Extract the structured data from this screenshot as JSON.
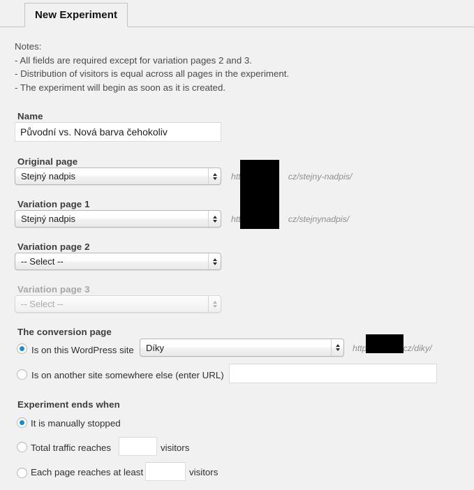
{
  "tab": {
    "label": "New Experiment"
  },
  "notes": {
    "heading": "Notes:",
    "lines": [
      "- All fields are required except for variation pages 2 and 3.",
      "- Distribution of visitors is equal across all pages in the experiment.",
      "- The experiment will begin as soon as it is created."
    ]
  },
  "name_field": {
    "label": "Name",
    "value": "Původní vs. Nová barva čehokoliv",
    "placeholder": ""
  },
  "original_page": {
    "label": "Original page",
    "selected": "Stejný nadpis",
    "url_prefix": "htt",
    "url_suffix": "cz/stejny-nadpis/"
  },
  "variation_page_1": {
    "label": "Variation page 1",
    "selected": "Stejný nadpis",
    "url_prefix": "htt",
    "url_suffix": "cz/stejnynadpis/"
  },
  "variation_page_2": {
    "label": "Variation page 2",
    "selected": "-- Select --"
  },
  "variation_page_3": {
    "label": "Variation page 3",
    "selected": "-- Select --",
    "state": "disabled"
  },
  "conversion_page": {
    "label": "The conversion page",
    "option_this_site_label": "Is on this WordPress site",
    "selected": "Díky",
    "url_prefix": "http",
    "url_suffix": "cz/diky/",
    "option_other_site_label": "Is on another site somewhere else (enter URL)",
    "other_site_url_value": "",
    "other_site_url_placeholder": ""
  },
  "experiment_ends": {
    "label": "Experiment ends when",
    "option_manual_label": "It is manually stopped",
    "option_total_traffic_label": "Total traffic reaches",
    "total_traffic_value": "",
    "total_traffic_suffix": "visitors",
    "option_each_page_label": "Each page reaches at least",
    "each_page_value": "",
    "each_page_suffix": "visitors"
  },
  "colors": {
    "background": "#f1f1f1",
    "radio_accent": "#1e8cbe",
    "border": "#c3c3c3",
    "text": "#2f2f2f"
  }
}
